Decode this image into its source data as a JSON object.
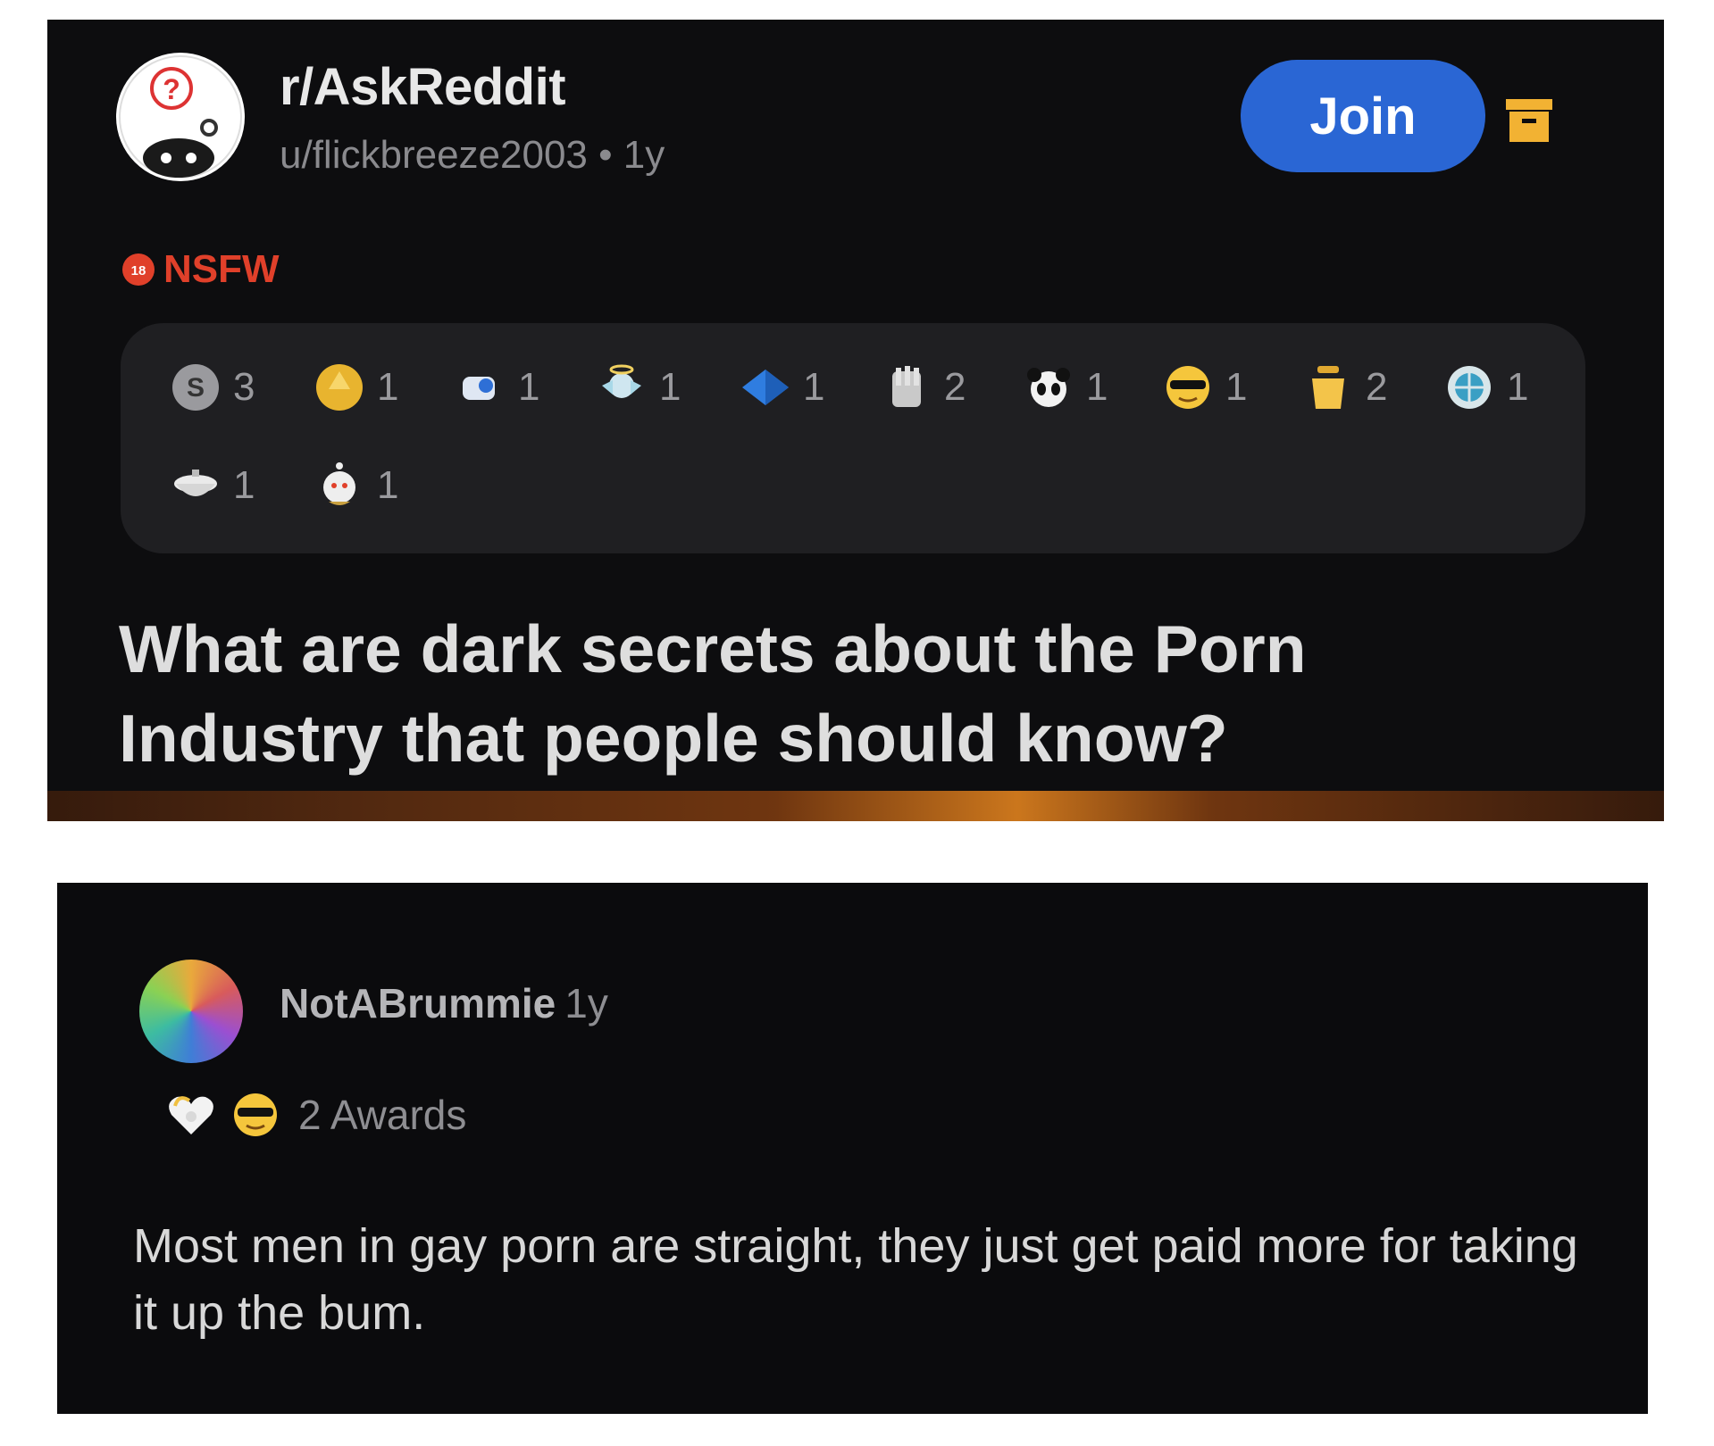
{
  "post": {
    "subreddit": "r/AskReddit",
    "meta": "u/flickbreeze2003 • 1y",
    "join_label": "Join",
    "nsfw_label": "NSFW",
    "awards": [
      {
        "icon": "silver-award-icon",
        "count": "3"
      },
      {
        "icon": "gold-award-icon",
        "count": "1"
      },
      {
        "icon": "tipsy-award-icon",
        "count": "1"
      },
      {
        "icon": "angel-award-icon",
        "count": "1"
      },
      {
        "icon": "book-award-icon",
        "count": "1"
      },
      {
        "icon": "facepalm-award-icon",
        "count": "2"
      },
      {
        "icon": "panda-award-icon",
        "count": "1"
      },
      {
        "icon": "sunglasses-award-icon",
        "count": "1"
      },
      {
        "icon": "jar-award-icon",
        "count": "2"
      },
      {
        "icon": "globe-award-icon",
        "count": "1"
      },
      {
        "icon": "toilet-award-icon",
        "count": "1"
      },
      {
        "icon": "snoo-award-icon",
        "count": "1"
      }
    ],
    "title": "What are dark secrets about the Porn Industry that people should know?"
  },
  "comment": {
    "author": "NotABrummie",
    "time": "1y",
    "awards_label": "2 Awards",
    "award_icons": [
      "heart-award-icon",
      "sunglasses-award-icon"
    ],
    "body": "Most men in gay porn are straight, they just get paid more for taking it up the bum."
  },
  "colors": {
    "panel_bg": "#0d0d0f",
    "join_blue": "#2a66d4",
    "nsfw_red": "#e0402a",
    "archive_yellow": "#f2b233"
  }
}
